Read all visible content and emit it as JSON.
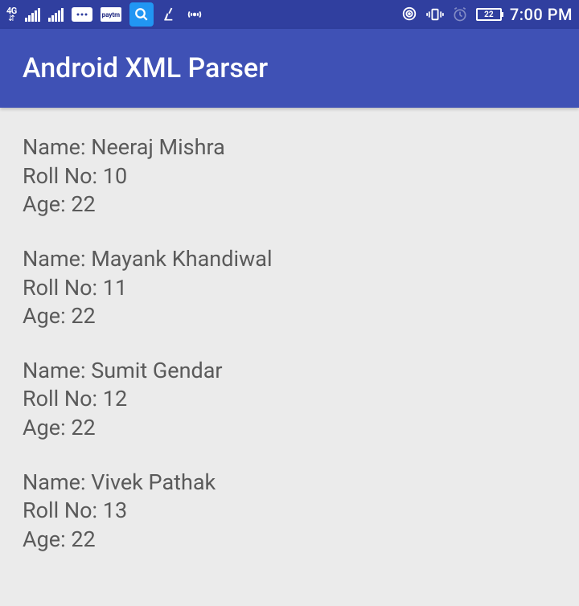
{
  "status": {
    "network_label": "4G",
    "battery_text": "22",
    "clock": "7:00 PM"
  },
  "app": {
    "title": "Android XML Parser"
  },
  "labels": {
    "name": "Name:",
    "roll": "Roll No:",
    "age": "Age:"
  },
  "records": [
    {
      "name": "Neeraj Mishra",
      "roll": "10",
      "age": "22"
    },
    {
      "name": "Mayank Khandiwal",
      "roll": "11",
      "age": "22"
    },
    {
      "name": "Sumit Gendar",
      "roll": "12",
      "age": "22"
    },
    {
      "name": "Vivek Pathak",
      "roll": "13",
      "age": "22"
    }
  ]
}
